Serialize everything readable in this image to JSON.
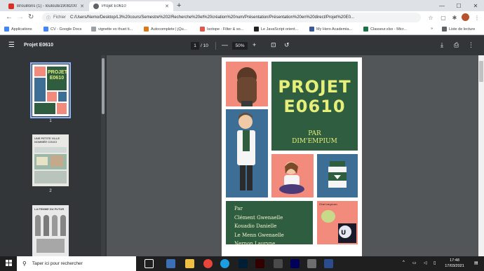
{
  "browser": {
    "tabs": [
      {
        "title": "Brouillons (1) - louloute19082001",
        "active": false,
        "favicon_color": "#d93025"
      },
      {
        "title": "Projet E0610",
        "active": true,
        "favicon_color": "#5f6368"
      }
    ],
    "new_tab_label": "+",
    "url_scheme_label": "Fichier",
    "url": "C:/Users/Nemo/Desktop/L3%20cours/Semestre%202/Recherche%20et%20création%20num/Présentation/Présentation%20en%20direct/Projet%20E0..."
  },
  "bookmarks": [
    {
      "label": "Applications",
      "color": "#4285f4"
    },
    {
      "label": "CV - Google Docs",
      "color": "#4285f4"
    },
    {
      "label": "vignette vo thuet ti...",
      "color": "#9aa0a6"
    },
    {
      "label": "Autocomplete | jQu...",
      "color": "#d97a1a"
    },
    {
      "label": "Isotope · Filter & so...",
      "color": "#e2574c"
    },
    {
      "label": "Le JavaScript orient...",
      "color": "#202124"
    },
    {
      "label": "My Hero Academia...",
      "color": "#3b5998"
    },
    {
      "label": "Classeur.xlsx - Micr...",
      "color": "#1e7145"
    }
  ],
  "bookmarks_more": "»",
  "reading_list": "Liste de lecture",
  "pdf": {
    "title": "Projet E0610",
    "current_page": "1",
    "total_pages": "/ 10",
    "zoom": "50%",
    "thumbnails": [
      {
        "num": "1",
        "caption": "PROJET E0610"
      },
      {
        "num": "2",
        "caption": "UNE PETITE VILLE NOMMÉE COUCI"
      },
      {
        "num": "",
        "caption": "LA FEMME DU FUTUR"
      }
    ]
  },
  "cover": {
    "title_line1": "PROJET",
    "title_line2": "E0610",
    "by": "PAR",
    "author": "DIM'EMPIUM",
    "credits_heading": "Par",
    "credits": [
      "Clément Gwenaelle",
      "Kouadio Danielle",
      "Le Menn Gwenaelle",
      "Nernon Lauryne"
    ],
    "logo_text": "Dim'empium",
    "colors": {
      "green": "#2f5d3f",
      "salmon": "#f28b7b",
      "blue": "#3d6e95",
      "yellow": "#e5ef7a"
    }
  },
  "taskbar": {
    "search_placeholder": "Taper ici pour rechercher",
    "time": "17:48",
    "date": "17/03/2021"
  }
}
